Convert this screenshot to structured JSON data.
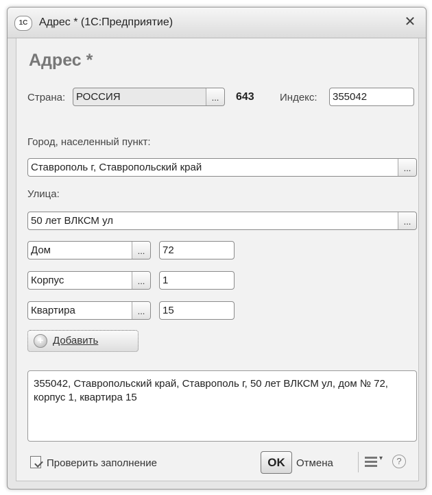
{
  "window": {
    "icon_text": "1С",
    "title": "Адрес * (1С:Предприятие)",
    "close_symbol": "✕"
  },
  "form": {
    "title": "Адрес *",
    "country_label": "Страна:",
    "country_value": "РОССИЯ",
    "country_code": "643",
    "index_label": "Индекс:",
    "index_value": "355042",
    "city_label": "Город, населенный пункт:",
    "city_value": "Ставрополь г, Ставропольский край",
    "street_label": "Улица:",
    "street_value": "50 лет ВЛКСМ ул",
    "rows": [
      {
        "type": "Дом",
        "value": "72"
      },
      {
        "type": "Корпус",
        "value": "1"
      },
      {
        "type": "Квартира",
        "value": "15"
      }
    ],
    "add_label": "Добавить",
    "address_full": "355042, Ставропольский край, Ставрополь г, 50 лет ВЛКСМ ул, дом № 72, корпус 1, квартира 15",
    "dots": "..."
  },
  "footer": {
    "check_label": "Проверить заполнение",
    "ok_label": "OK",
    "cancel_label": "Отмена",
    "menu_arrow": "▾",
    "help_symbol": "?"
  },
  "icons": {
    "app": "app-1c-icon",
    "close": "close-icon",
    "add": "plus-circle-icon",
    "check": "check-document-icon",
    "menu": "menu-icon",
    "help": "help-icon"
  }
}
